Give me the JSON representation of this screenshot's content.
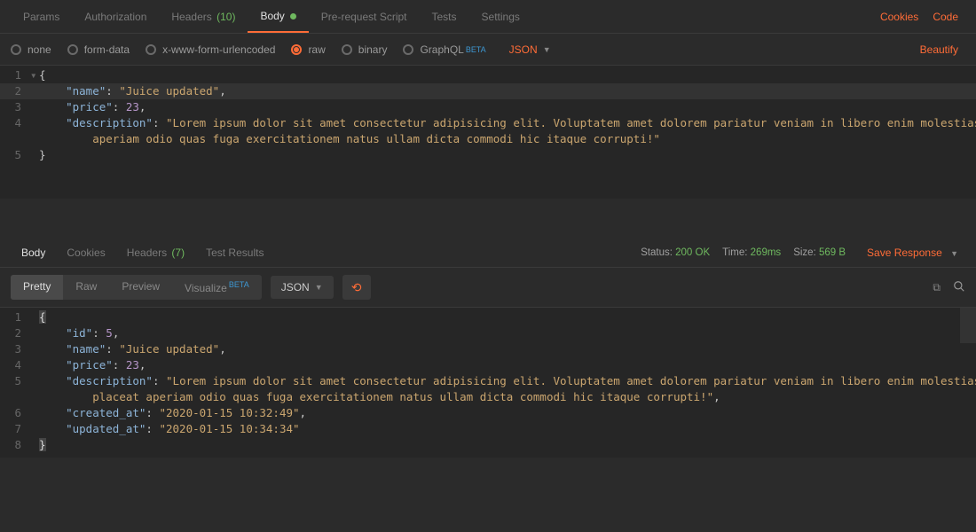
{
  "request_tabs": {
    "items": [
      {
        "label": "Params",
        "active": false
      },
      {
        "label": "Authorization",
        "active": false
      },
      {
        "label": "Headers",
        "count": "(10)",
        "active": false
      },
      {
        "label": "Body",
        "dot": true,
        "active": true
      },
      {
        "label": "Pre-request Script",
        "active": false
      },
      {
        "label": "Tests",
        "active": false
      },
      {
        "label": "Settings",
        "active": false
      }
    ],
    "right_links": [
      "Cookies",
      "Code"
    ]
  },
  "body_types": {
    "items": [
      {
        "label": "none",
        "sel": false
      },
      {
        "label": "form-data",
        "sel": false
      },
      {
        "label": "x-www-form-urlencoded",
        "sel": false
      },
      {
        "label": "raw",
        "sel": true
      },
      {
        "label": "binary",
        "sel": false
      },
      {
        "label": "GraphQL",
        "beta": true,
        "sel": false
      }
    ],
    "lang": "JSON",
    "beautify": "Beautify"
  },
  "request_body_json": {
    "name": "Juice updated",
    "price": 23,
    "description": "Lorem ipsum dolor sit amet consectetur adipisicing elit. Voluptatem amet dolorem pariatur veniam in libero enim molestias, placeat aperiam odio quas fuga exercitationem natus ullam dicta commodi hic itaque corrupti!"
  },
  "request_body_lines": [
    {
      "n": "1",
      "fold": "▾",
      "html": "<span class='p'>{</span>"
    },
    {
      "n": "2",
      "hl": true,
      "html": "    <span class='k'>\"name\"</span><span class='p'>: </span><span class='s'>\"Juice updated\"</span><span class='p'>,</span>"
    },
    {
      "n": "3",
      "html": "    <span class='k'>\"price\"</span><span class='p'>: </span><span class='n'>23</span><span class='p'>,</span>"
    },
    {
      "n": "4",
      "html": "    <span class='k'>\"description\"</span><span class='p'>: </span><span class='s'>\"Lorem ipsum dolor sit amet consectetur adipisicing elit. Voluptatem amet dolorem pariatur veniam in libero enim molestias, placeat</span>"
    },
    {
      "n": "",
      "html": "        <span class='s'>aperiam odio quas fuga exercitationem natus ullam dicta commodi hic itaque corrupti!\"</span>"
    },
    {
      "n": "5",
      "html": "<span class='p'>}</span>"
    }
  ],
  "response_tabs": {
    "items": [
      {
        "label": "Body",
        "active": true
      },
      {
        "label": "Cookies",
        "active": false
      },
      {
        "label": "Headers",
        "count": "(7)",
        "active": false
      },
      {
        "label": "Test Results",
        "active": false
      }
    ],
    "status": {
      "label": "Status:",
      "value": "200 OK"
    },
    "time": {
      "label": "Time:",
      "value": "269ms"
    },
    "size": {
      "label": "Size:",
      "value": "569 B"
    },
    "save": "Save Response"
  },
  "formatter": {
    "segs": [
      {
        "label": "Pretty",
        "active": true
      },
      {
        "label": "Raw",
        "active": false
      },
      {
        "label": "Preview",
        "active": false
      },
      {
        "label": "Visualize",
        "beta": true,
        "active": false
      }
    ],
    "lang": "JSON"
  },
  "response_body_json": {
    "id": 5,
    "name": "Juice updated",
    "price": 23,
    "description": "Lorem ipsum dolor sit amet consectetur adipisicing elit. Voluptatem amet dolorem pariatur veniam in libero enim molestias, placeat aperiam odio quas fuga exercitationem natus ullam dicta commodi hic itaque corrupti!",
    "created_at": "2020-01-15 10:32:49",
    "updated_at": "2020-01-15 10:34:34"
  },
  "response_body_lines": [
    {
      "n": "1",
      "html": "<span class='car'>{</span>"
    },
    {
      "n": "2",
      "html": "    <span class='k'>\"id\"</span><span class='p'>: </span><span class='n'>5</span><span class='p'>,</span>"
    },
    {
      "n": "3",
      "html": "    <span class='k'>\"name\"</span><span class='p'>: </span><span class='s'>\"Juice updated\"</span><span class='p'>,</span>"
    },
    {
      "n": "4",
      "html": "    <span class='k'>\"price\"</span><span class='p'>: </span><span class='n'>23</span><span class='p'>,</span>"
    },
    {
      "n": "5",
      "html": "    <span class='k'>\"description\"</span><span class='p'>: </span><span class='s'>\"Lorem ipsum dolor sit amet consectetur adipisicing elit. Voluptatem amet dolorem pariatur veniam in libero enim molestias,</span>"
    },
    {
      "n": "",
      "html": "        <span class='s'>placeat aperiam odio quas fuga exercitationem natus ullam dicta commodi hic itaque corrupti!\"</span><span class='p'>,</span>"
    },
    {
      "n": "6",
      "html": "    <span class='k'>\"created_at\"</span><span class='p'>: </span><span class='s'>\"2020-01-15 10:32:49\"</span><span class='p'>,</span>"
    },
    {
      "n": "7",
      "html": "    <span class='k'>\"updated_at\"</span><span class='p'>: </span><span class='s'>\"2020-01-15 10:34:34\"</span>"
    },
    {
      "n": "8",
      "html": "<span class='car'>}</span>"
    }
  ]
}
